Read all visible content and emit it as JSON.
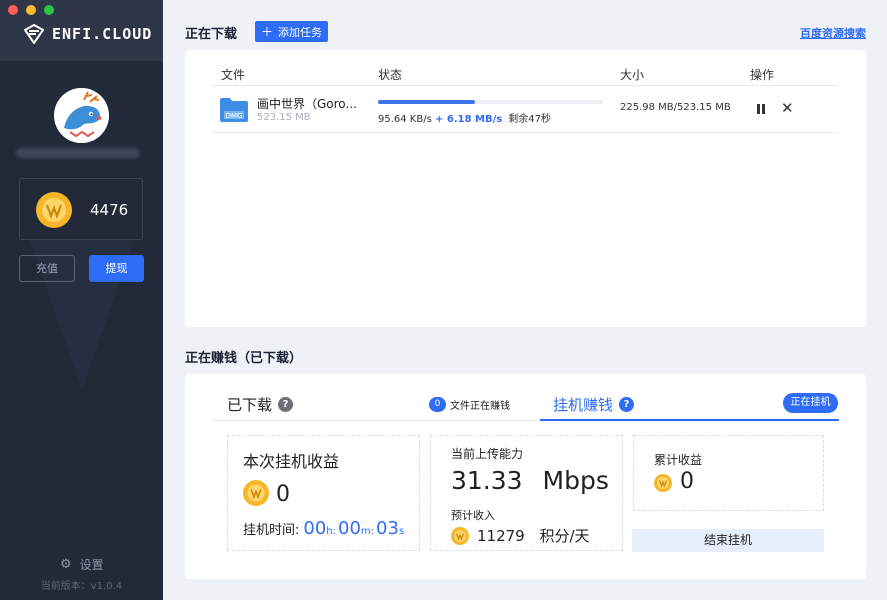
{
  "brand": {
    "name": "ENFI.CLOUD",
    "accent": "#2f6cf6"
  },
  "sidebar": {
    "coin_balance": "4476",
    "recharge_label": "充值",
    "withdraw_label": "提现",
    "settings_label": "设置",
    "version_text": "当前版本：v1.0.4"
  },
  "downloading": {
    "title": "正在下载",
    "add_task_label": "添加任务",
    "baidu_search_label": "百度资源搜索",
    "columns": {
      "file": "文件",
      "status": "状态",
      "size": "大小",
      "actions": "操作"
    },
    "tasks": [
      {
        "file_type": "DMG",
        "name": "画中世界（Goro...",
        "total_size": "523.15 MB",
        "progress": 0.43,
        "speed_normal": "95.64 KB/s",
        "speed_boost": "+ 6.18 MB/s",
        "remaining": "剩余47秒",
        "size_progress": "225.98 MB/523.15 MB"
      }
    ]
  },
  "earning": {
    "title": "正在赚钱（已下载）",
    "tab_downloaded": "已下载",
    "earning_file_count": "0",
    "earning_file_label": "文件正在赚钱",
    "tab_mining": "挂机赚钱",
    "status_pill": "正在挂机",
    "session": {
      "label": "本次挂机收益",
      "value": "0",
      "time_label": "挂机时间:",
      "hours": "00",
      "hours_unit": "h:",
      "minutes": "00",
      "minutes_unit": "m:",
      "seconds": "03",
      "seconds_unit": "s"
    },
    "upload": {
      "label": "当前上传能力",
      "value": "31.33",
      "unit": "Mbps",
      "estimated_label": "预计收入",
      "estimated_value": "11279",
      "estimated_unit": "积分/天"
    },
    "cumulative": {
      "label": "累计收益",
      "value": "0"
    },
    "end_button_label": "结束挂机"
  }
}
